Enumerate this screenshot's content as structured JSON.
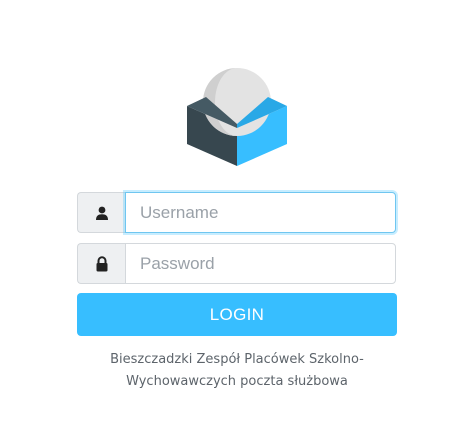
{
  "logo": {
    "icon": "roundcube-logo"
  },
  "form": {
    "username": {
      "placeholder": "Username",
      "icon": "user-icon",
      "value": ""
    },
    "password": {
      "placeholder": "Password",
      "icon": "lock-icon",
      "value": ""
    },
    "login_label": "LOGIN"
  },
  "footer": {
    "line1": "Bieszczadzki Zespół Placówek Szkolno-",
    "line2": "Wychowawczych poczta służbowa"
  },
  "colors": {
    "accent": "#37beff",
    "box_dark": "#37474f",
    "box_light": "#37beff",
    "sphere": "#e0e0e0"
  }
}
